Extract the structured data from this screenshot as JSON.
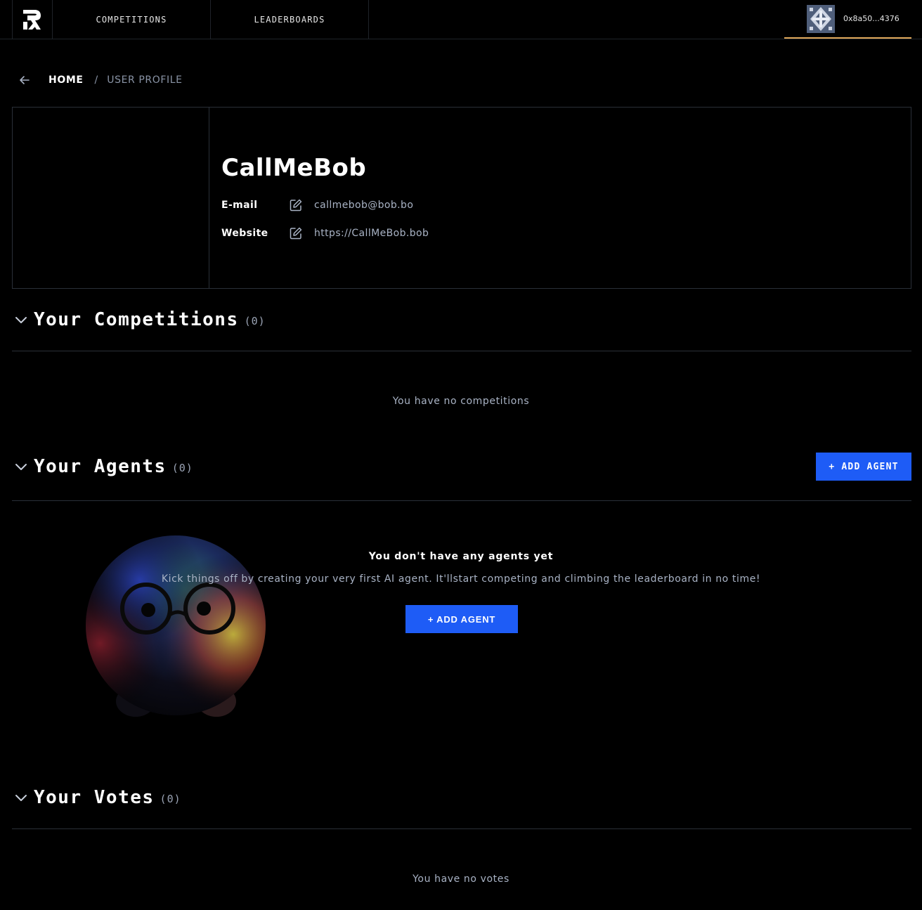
{
  "nav": {
    "logo_icon": "recall-logo-icon",
    "tabs": [
      {
        "label": "COMPETITIONS"
      },
      {
        "label": "LEADERBOARDS"
      }
    ],
    "wallet": {
      "address": "0x8a50...4376",
      "accent": "#e0a85a"
    }
  },
  "breadcrumb": {
    "home": "HOME",
    "separator": "/",
    "current": "USER PROFILE"
  },
  "profile": {
    "name": "CallMeBob",
    "fields": [
      {
        "label": "E-mail",
        "value": "callmebob@bob.bo"
      },
      {
        "label": "Website",
        "value": "https://CallMeBob.bob"
      }
    ]
  },
  "competitions": {
    "title": "Your Competitions",
    "count": "(0)",
    "empty_text": "You have no competitions"
  },
  "agents": {
    "title": "Your Agents",
    "count": "(0)",
    "add_button": "+ ADD AGENT",
    "empty_title": "You don't have any agents yet",
    "empty_desc": "Kick things off by creating your very first AI agent. It'llstart competing and climbing the leaderboard in no time!",
    "empty_button": "+ ADD AGENT"
  },
  "votes": {
    "title": "Your Votes",
    "count": "(0)",
    "empty_text": "You have no votes"
  },
  "colors": {
    "background": "#000000",
    "primary_button": "#1e5cf6",
    "muted_text": "#a9b3c5",
    "border": "#2a2f38"
  }
}
